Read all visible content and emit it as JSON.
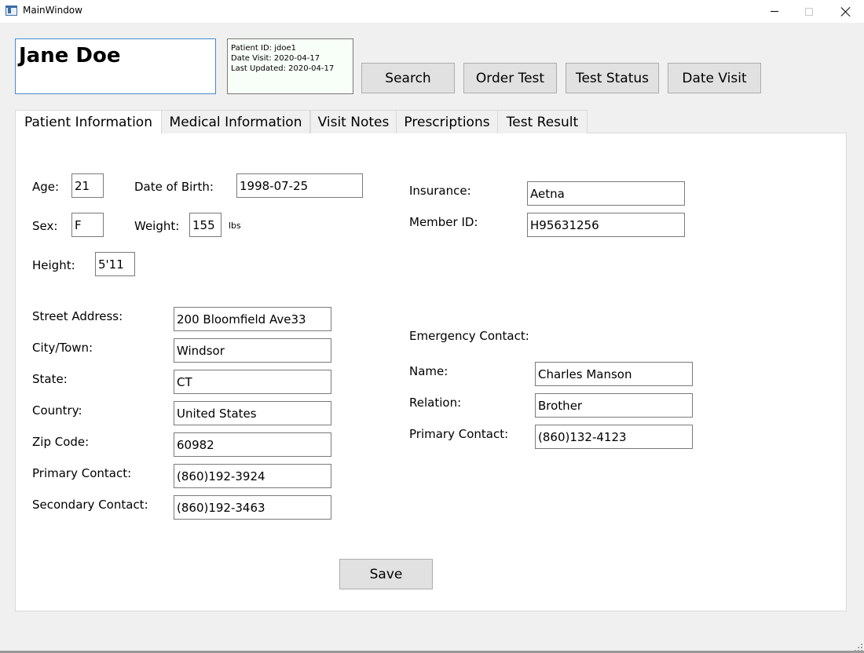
{
  "window": {
    "title": "MainWindow",
    "icon": "app-window-icon"
  },
  "header": {
    "patient_name": "Jane Doe",
    "patient_id": "Patient ID: jdoe1",
    "date_visit": "Date Visit: 2020-04-17",
    "last_updated": "Last Updated: 2020-04-17",
    "buttons": {
      "search": "Search",
      "order_test": "Order Test",
      "test_status": "Test Status",
      "date_visit": "Date Visit"
    }
  },
  "tabs": [
    {
      "label": "Patient Information",
      "active": true
    },
    {
      "label": "Medical Information",
      "active": false
    },
    {
      "label": "Visit Notes",
      "active": false
    },
    {
      "label": "Prescriptions",
      "active": false
    },
    {
      "label": "Test Result",
      "active": false
    }
  ],
  "patient_info": {
    "age": {
      "label": "Age:",
      "value": "21"
    },
    "dob": {
      "label": "Date of Birth:",
      "value": "1998-07-25"
    },
    "sex": {
      "label": "Sex:",
      "value": "F"
    },
    "weight": {
      "label": "Weight:",
      "value": "155",
      "unit": "lbs"
    },
    "height": {
      "label": "Height:",
      "value": "5'11"
    },
    "insurance": {
      "label": "Insurance:",
      "value": "Aetna"
    },
    "member_id": {
      "label": "Member ID:",
      "value": "H95631256"
    },
    "street": {
      "label": "Street Address:",
      "value": "200 Bloomfield Ave33"
    },
    "city": {
      "label": "City/Town:",
      "value": "Windsor"
    },
    "state": {
      "label": "State:",
      "value": "CT"
    },
    "country": {
      "label": "Country:",
      "value": "United States"
    },
    "zip": {
      "label": "Zip Code:",
      "value": "60982"
    },
    "primary_contact": {
      "label": "Primary Contact:",
      "value": "(860)192-3924"
    },
    "secondary_contact": {
      "label": "Secondary Contact:",
      "value": "(860)192-3463"
    }
  },
  "emergency": {
    "heading": "Emergency Contact:",
    "name": {
      "label": "Name:",
      "value": "Charles Manson"
    },
    "relation": {
      "label": "Relation:",
      "value": "Brother"
    },
    "primary": {
      "label": "Primary Contact:",
      "value": "(860)132-4123"
    }
  },
  "actions": {
    "save": "Save"
  }
}
